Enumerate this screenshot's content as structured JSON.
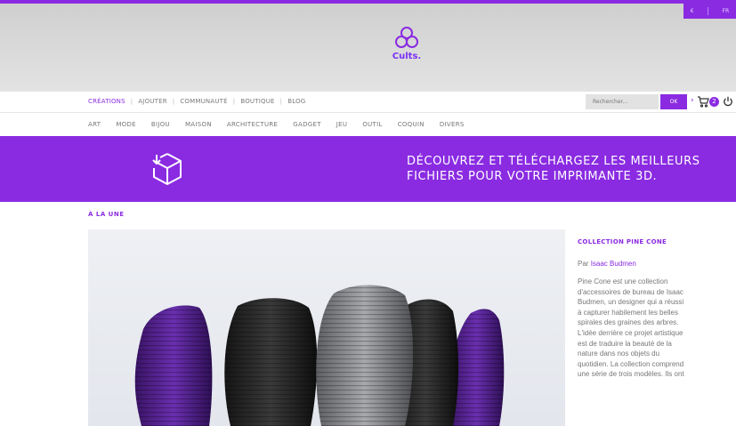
{
  "colors": {
    "accent": "#8a2be2",
    "header_bg": "#d9d9d9",
    "text_muted": "#777777"
  },
  "lang_bar": {
    "prev": "€",
    "current": "FR"
  },
  "brand": {
    "name": "Cults.",
    "icon": "cults-logo-icon"
  },
  "main_nav": {
    "items": [
      {
        "label": "CRÉATIONS",
        "active": true
      },
      {
        "label": "AJOUTER",
        "active": false
      },
      {
        "label": "COMMUNAUTÉ",
        "active": false
      },
      {
        "label": "BOUTIQUE",
        "active": false
      },
      {
        "label": "BLOG",
        "active": false
      }
    ]
  },
  "search": {
    "placeholder": "Rechercher...",
    "button": "OK"
  },
  "user": {
    "cart_icon": "cart-icon",
    "cart_count": "2",
    "power_icon": "power-icon",
    "arrow": "›"
  },
  "categories": [
    "ART",
    "MODE",
    "BIJOU",
    "MAISON",
    "ARCHITECTURE",
    "GADGET",
    "JEU",
    "OUTIL",
    "COQUIN",
    "DIVERS"
  ],
  "banner": {
    "icon": "download-box-icon",
    "tagline": "DÉCOUVREZ ET TÉLÉCHARGEZ LES MEILLEURS FICHIERS POUR VOTRE IMPRIMANTE 3D."
  },
  "featured": {
    "section_title": "À LA UNE",
    "collection_title": "COLLECTION PINE CONE",
    "by_prefix": "Par",
    "author": "Isaac Budmen",
    "description": "Pine Cone est une collection d'accessoires de bureau de Isaac Budmen, un designer qui a réussi à capturer habilement les belles spirales des graines des arbres. L'idée derrière ce projet artistique est de traduire la beauté de la nature dans nos objets du quotidien. La collection comprend une série de trois modèles. Ils ont"
  }
}
